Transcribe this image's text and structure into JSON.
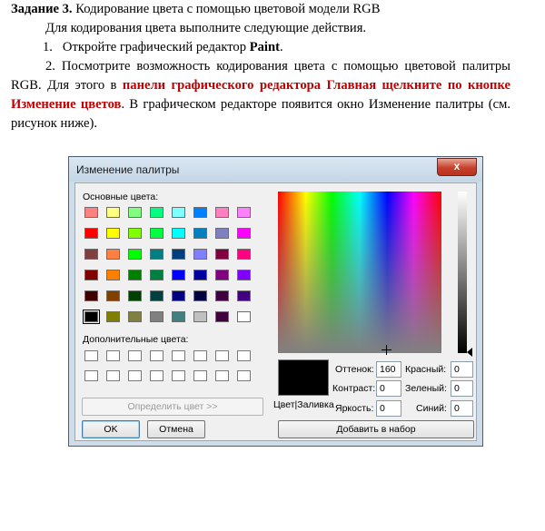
{
  "document": {
    "heading_bold": "Задание 3.",
    "heading_rest": " Кодирование цвета с помощью цветовой модели RGB",
    "intro": "Для кодирования цвета выполните следующие действия.",
    "step1_num": "1.",
    "step1_text": "Откройте графический редактор ",
    "step1_app": "Paint",
    "step1_end": ".",
    "step2_start": "2. Посмотрите возможность кодирования цвета с помощью цветовой палитры RGB. Для этого в ",
    "step2_red": "панели графического редактора Главная щелкните по кнопке Изменение цветов",
    "step2_end": ". В графическом редакторе появится окно Изменение палитры (см. рисунок ниже)."
  },
  "dialog": {
    "title": "Изменение палитры",
    "close_label": "x",
    "basic_colors_label": "Основные цвета:",
    "custom_colors_label": "Дополнительные цвета:",
    "define_button": "Определить цвет >>",
    "ok_button": "OK",
    "cancel_button": "Отмена",
    "color_solid_label": "Цвет|Заливка",
    "hue_label": "Оттенок:",
    "hue_value": "160",
    "sat_label": "Контраст:",
    "sat_value": "0",
    "lum_label": "Яркость:",
    "lum_value": "0",
    "red_label": "Красный:",
    "red_value": "0",
    "green_label": "Зеленый:",
    "green_value": "0",
    "blue_label": "Синий:",
    "blue_value": "0",
    "add_button": "Добавить в набор",
    "basic_colors": [
      [
        "#ff8080",
        "#ffff80",
        "#80ff80",
        "#00ff80",
        "#80ffff",
        "#0080ff",
        "#ff80c0",
        "#ff80ff"
      ],
      [
        "#ff0000",
        "#ffff00",
        "#80ff00",
        "#00ff40",
        "#00ffff",
        "#0080c0",
        "#8080c0",
        "#ff00ff"
      ],
      [
        "#804040",
        "#ff8040",
        "#00ff00",
        "#008080",
        "#004080",
        "#8080ff",
        "#800040",
        "#ff0080"
      ],
      [
        "#800000",
        "#ff8000",
        "#008000",
        "#008040",
        "#0000ff",
        "#0000a0",
        "#800080",
        "#8000ff"
      ],
      [
        "#400000",
        "#804000",
        "#004000",
        "#004040",
        "#000080",
        "#000040",
        "#400040",
        "#400080"
      ],
      [
        "#000000",
        "#808000",
        "#808040",
        "#808080",
        "#408080",
        "#c0c0c0",
        "#400040",
        "#ffffff"
      ]
    ]
  }
}
